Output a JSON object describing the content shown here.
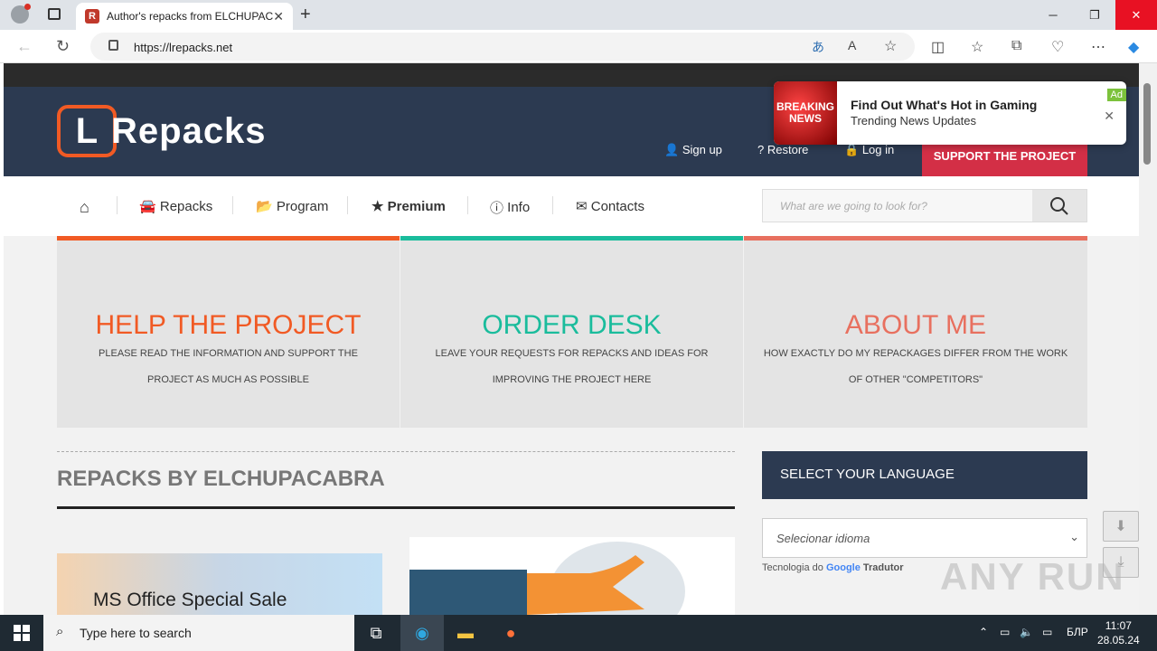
{
  "browser": {
    "tab_title": "Author's repacks from ELCHUPAC",
    "url": "https://lrepacks.net",
    "win_minimize": "─",
    "win_maximize": "❐",
    "win_close": "✕"
  },
  "header": {
    "logo_letter": "L",
    "logo_text": "Repacks",
    "signup": "Sign up",
    "restore": "Restore",
    "login": "Log in",
    "support": "SUPPORT THE PROJECT"
  },
  "nav": {
    "items": [
      {
        "label": ""
      },
      {
        "label": "Repacks"
      },
      {
        "label": "Program"
      },
      {
        "label": "Premium"
      },
      {
        "label": "Info"
      },
      {
        "label": "Contacts"
      }
    ],
    "search_placeholder": "What are we going to look for?"
  },
  "panels": [
    {
      "title": "HELP THE PROJECT",
      "text": "PLEASE READ THE INFORMATION AND SUPPORT THE PROJECT AS MUCH AS POSSIBLE",
      "color": "#f15a24"
    },
    {
      "title": "ORDER DESK",
      "text": "LEAVE YOUR REQUESTS FOR REPACKS AND IDEAS FOR IMPROVING THE PROJECT HERE",
      "color": "#1abc9c"
    },
    {
      "title": "ABOUT ME",
      "text": "HOW EXACTLY DO MY REPACKAGES DIFFER FROM THE WORK OF OTHER \"COMPETITORS\"",
      "color": "#e8705f"
    }
  ],
  "main": {
    "section_title": "REPACKS BY ELCHUPACABRA",
    "thumb1_text": "MS Office Special Sale"
  },
  "sidebar": {
    "language_title": "SELECT YOUR LANGUAGE",
    "language_select": "Selecionar idioma",
    "powered_prefix": "Tecnologia do",
    "powered_google": "Google",
    "powered_suffix": "Tradutor"
  },
  "ad": {
    "image_text": "BREAKING NEWS",
    "headline": "Find Out What's Hot in Gaming",
    "subline": "Trending News Updates",
    "badge": "Ad"
  },
  "taskbar": {
    "search_placeholder": "Type here to search",
    "lang": "БЛР",
    "time": "11:07",
    "date": "28.05.24"
  },
  "watermark": "ANY RUN"
}
